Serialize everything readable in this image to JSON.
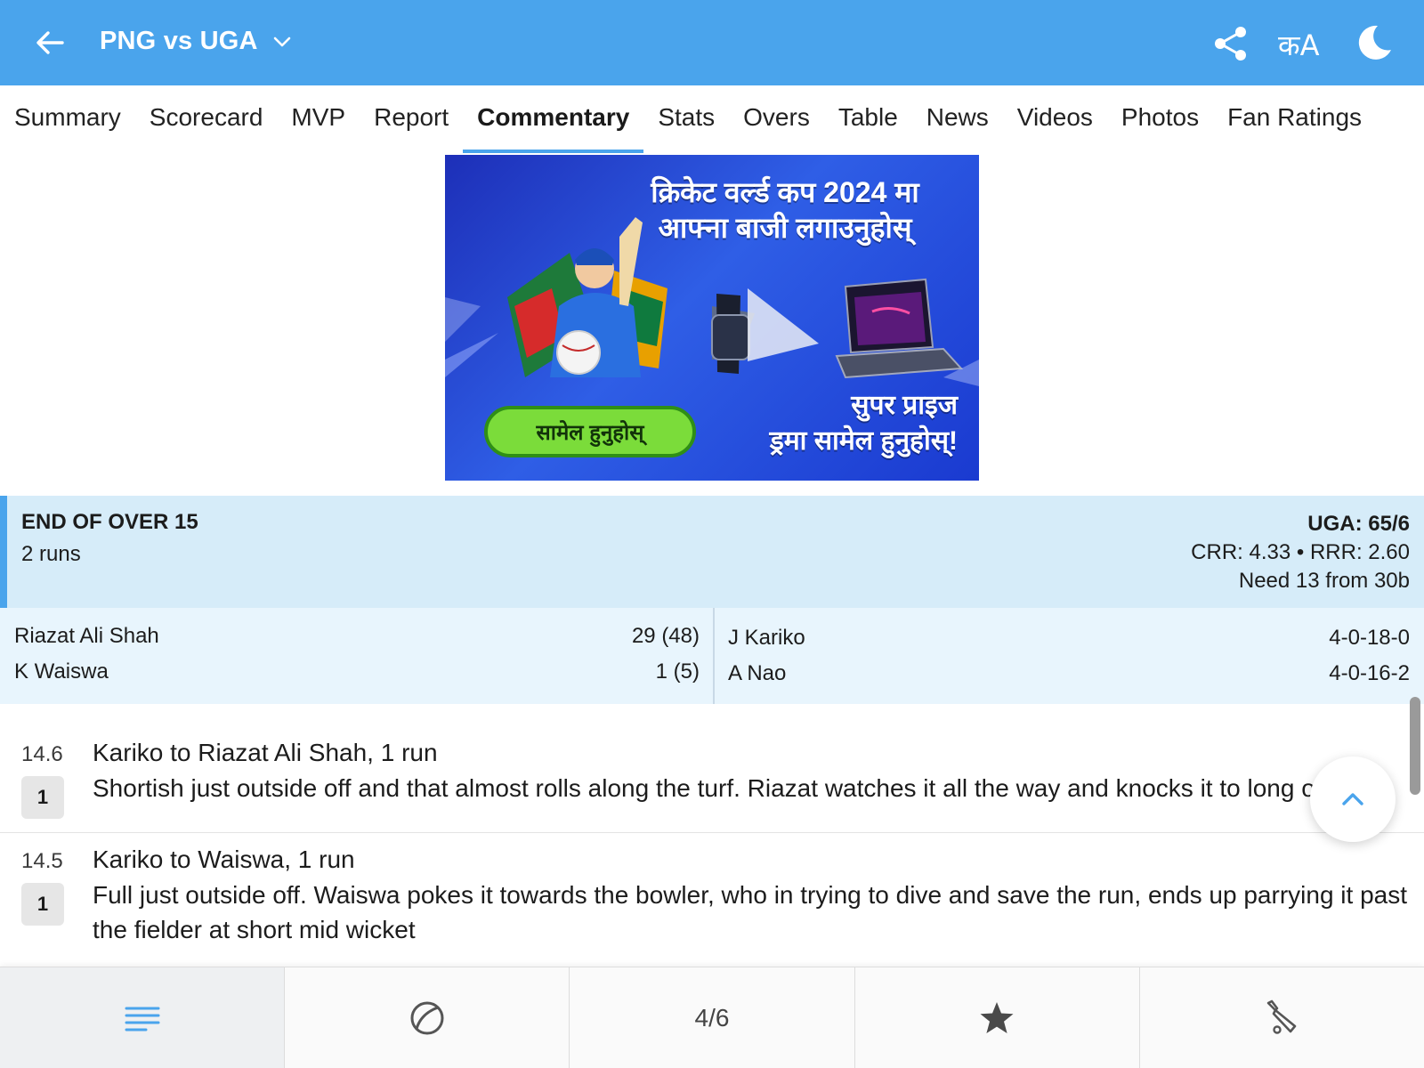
{
  "header": {
    "title": "PNG vs UGA",
    "lang_label": "कA",
    "accent_color": "#4aa4ec",
    "icons": [
      "arrow-left-icon",
      "chevron-down-icon",
      "share-icon",
      "language-icon",
      "moon-icon"
    ]
  },
  "tabs": [
    {
      "label": "Summary",
      "active": false
    },
    {
      "label": "Scorecard",
      "active": false
    },
    {
      "label": "MVP",
      "active": false
    },
    {
      "label": "Report",
      "active": false
    },
    {
      "label": "Commentary",
      "active": true
    },
    {
      "label": "Stats",
      "active": false
    },
    {
      "label": "Overs",
      "active": false
    },
    {
      "label": "Table",
      "active": false
    },
    {
      "label": "News",
      "active": false
    },
    {
      "label": "Videos",
      "active": false
    },
    {
      "label": "Photos",
      "active": false
    },
    {
      "label": "Fan Ratings",
      "active": false
    }
  ],
  "ad": {
    "headline_line1": "क्रिकेट वर्ल्ड कप 2024 मा",
    "headline_line2": "आफ्ना बाजी लगाउनुहोस्",
    "cta": "सामेल हुनुहोस्",
    "prize_line1": "सुपर प्राइज",
    "prize_line2": "ड्रमा सामेल हुनुहोस्!"
  },
  "over_summary": {
    "title": "END OF OVER 15",
    "runs": "2 runs",
    "score": "UGA: 65/6",
    "rates": "CRR: 4.33 • RRR: 2.60",
    "need": "Need 13 from 30b"
  },
  "batters": [
    {
      "name": "Riazat Ali Shah",
      "figures": "29 (48)"
    },
    {
      "name": "K Waiswa",
      "figures": "1 (5)"
    }
  ],
  "bowlers": [
    {
      "name": "J Kariko",
      "figures": "4-0-18-0"
    },
    {
      "name": "A Nao",
      "figures": "4-0-16-2"
    }
  ],
  "commentary": [
    {
      "over": "14.6",
      "runs": "1",
      "headline": "Kariko to Riazat Ali Shah, 1 run",
      "text": "Shortish just outside off and that almost rolls along the turf. Riazat watches it all the way and knocks it to long on"
    },
    {
      "over": "14.5",
      "runs": "1",
      "headline": "Kariko to Waiswa, 1 run",
      "text": "Full just outside off. Waiswa pokes it towards the bowler, who in trying to dive and save the run, ends up parrying it past the fielder at short mid wicket"
    }
  ],
  "bottom_nav": [
    {
      "icon": "menu-lines-icon",
      "label": "",
      "active": true
    },
    {
      "icon": "ball-icon",
      "label": "",
      "active": false
    },
    {
      "icon": "",
      "label": "4/6",
      "active": false
    },
    {
      "icon": "star-icon",
      "label": "",
      "active": false
    },
    {
      "icon": "bat-icon",
      "label": "",
      "active": false
    }
  ]
}
